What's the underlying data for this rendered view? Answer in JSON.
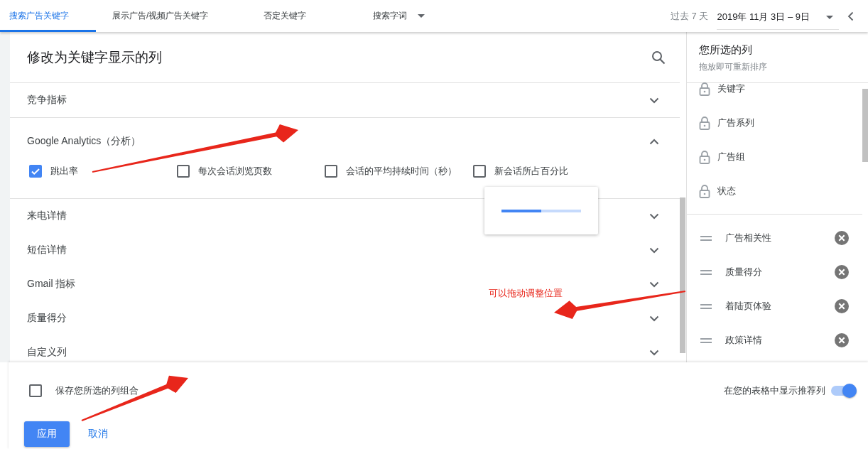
{
  "tabs": [
    {
      "label": "搜索广告关键字",
      "selected": true,
      "has_menu": false
    },
    {
      "label": "展示广告/视频广告关键字",
      "selected": false,
      "has_menu": false
    },
    {
      "label": "否定关键字",
      "selected": false,
      "has_menu": false
    },
    {
      "label": "搜索字词",
      "selected": false,
      "has_menu": true
    }
  ],
  "date_range": {
    "preset": "过去 7 天",
    "value": "2019年 11月 3日 – 9日"
  },
  "dialog": {
    "title": "修改为关键字显示的列",
    "groups": [
      {
        "label": "竞争指标",
        "expanded": false
      },
      {
        "label": "Google Analytics（分析）",
        "expanded": true,
        "options": [
          {
            "label": "跳出率",
            "checked": true
          },
          {
            "label": "每次会话浏览页数",
            "checked": false
          },
          {
            "label": "会话的平均持续时间（秒）",
            "checked": false
          },
          {
            "label": "新会话所占百分比",
            "checked": false
          }
        ]
      },
      {
        "label": "来电详情",
        "expanded": false
      },
      {
        "label": "短信详情",
        "expanded": false
      },
      {
        "label": "Gmail 指标",
        "expanded": false
      },
      {
        "label": "质量得分",
        "expanded": false
      },
      {
        "label": "自定义列",
        "expanded": false
      }
    ]
  },
  "selected_columns": {
    "title": "您所选的列",
    "hint": "拖放即可重新排序",
    "items": [
      {
        "label": "关键字",
        "kind": "locked"
      },
      {
        "label": "广告系列",
        "kind": "locked"
      },
      {
        "label": "广告组",
        "kind": "locked"
      },
      {
        "label": "状态",
        "kind": "locked"
      },
      {
        "label": "广告相关性",
        "kind": "removable"
      },
      {
        "label": "质量得分",
        "kind": "removable"
      },
      {
        "label": "着陆页体验",
        "kind": "removable"
      },
      {
        "label": "政策详情",
        "kind": "removable"
      }
    ]
  },
  "loading": {
    "level": 0.5
  },
  "footer": {
    "save_option": {
      "label": "保存您所选的列组合",
      "checked": false
    },
    "recommended_toggle": {
      "label": "在您的表格中显示推荐列",
      "on": true
    },
    "buttons": [
      {
        "label": "应用",
        "kind": "primary"
      },
      {
        "label": "取消",
        "kind": "text"
      }
    ]
  },
  "annotation": {
    "note": "可以拖动调整位置"
  }
}
